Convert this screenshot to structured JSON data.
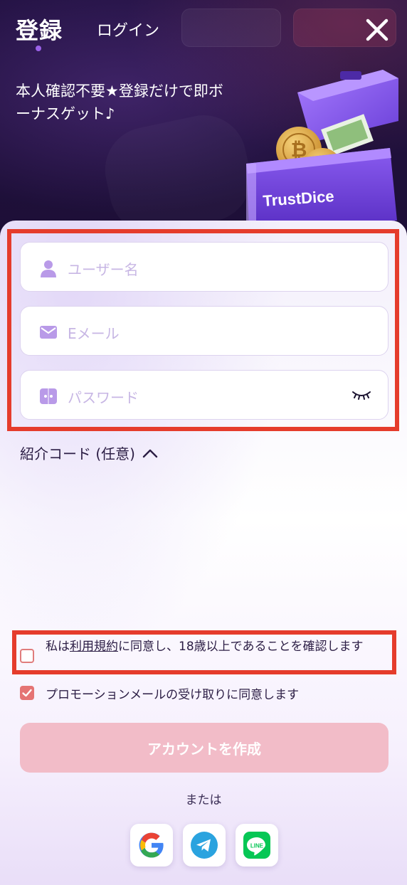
{
  "header": {
    "tab_register": "登録",
    "tab_login": "ログイン",
    "promo_line1": "本人確認不要★登録だけで即ボ",
    "promo_line2": "ーナスゲット♪",
    "brand": "TrustDice"
  },
  "form": {
    "username_placeholder": "ユーザー名",
    "email_placeholder": "Eメール",
    "password_placeholder": "パスワード",
    "referral_label": "紹介コード (任意)"
  },
  "terms": {
    "before": "私は",
    "link": "利用規約",
    "after": "に同意し、18歳以上であることを確認します",
    "checked": false
  },
  "promo_consent": {
    "label": "プロモーションメールの受け取りに同意します",
    "checked": true
  },
  "actions": {
    "create_account": "アカウントを作成",
    "or": "または"
  },
  "social": [
    "google-icon",
    "telegram-icon",
    "line-icon"
  ],
  "colors": {
    "accent": "#9b62e8",
    "highlight": "#e53c2c",
    "button_disabled": "#f2bcc8",
    "checkbox": "#e57474"
  }
}
